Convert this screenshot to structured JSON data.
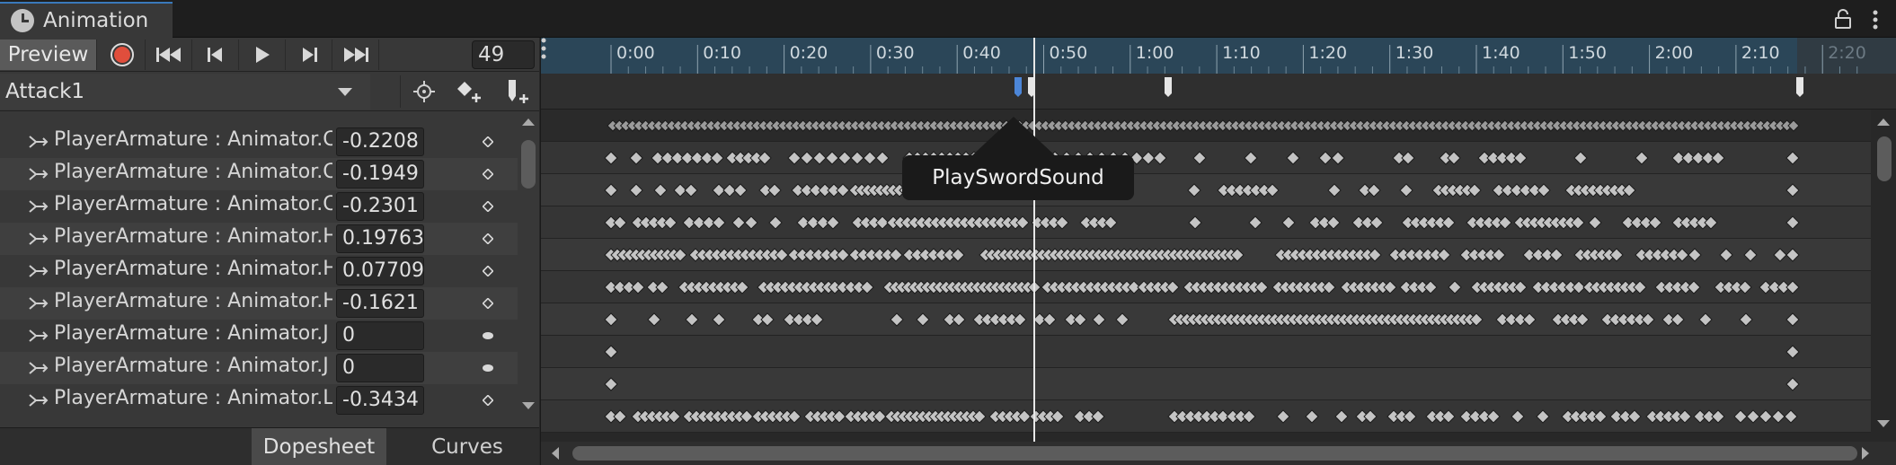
{
  "window": {
    "title": "Animation",
    "tab_icon": "animation-clock-icon",
    "lock_icon": "lock-icon",
    "menu_icon": "kebab-menu-icon"
  },
  "toolbar": {
    "preview_label": "Preview",
    "frame": "49",
    "record_color": "#e04e3c"
  },
  "clip": {
    "name": "Attack1"
  },
  "properties": [
    {
      "name": "PlayerArmature : Animator.C",
      "value": "-0.2208",
      "key": "diamond"
    },
    {
      "name": "PlayerArmature : Animator.C",
      "value": "-0.1949",
      "key": "diamond"
    },
    {
      "name": "PlayerArmature : Animator.C",
      "value": "-0.2301",
      "key": "diamond"
    },
    {
      "name": "PlayerArmature : Animator.H",
      "value": "0.19763",
      "key": "diamond"
    },
    {
      "name": "PlayerArmature : Animator.H",
      "value": "0.07709",
      "key": "diamond"
    },
    {
      "name": "PlayerArmature : Animator.H",
      "value": "-0.1621",
      "key": "diamond"
    },
    {
      "name": "PlayerArmature : Animator.J",
      "value": "0",
      "key": "ellipse"
    },
    {
      "name": "PlayerArmature : Animator.J",
      "value": "0",
      "key": "ellipse"
    },
    {
      "name": "PlayerArmature : Animator.L",
      "value": "-0.3434",
      "key": "diamond"
    }
  ],
  "bottom_tabs": {
    "dopesheet": "Dopesheet",
    "curves": "Curves"
  },
  "timeline": {
    "ticks": [
      "0:00",
      "0:10",
      "0:20",
      "0:30",
      "0:40",
      "0:50",
      "1:00",
      "1:10",
      "1:20",
      "1:30",
      "1:40",
      "1:50",
      "2:00",
      "2:10",
      "2:20"
    ],
    "playhead_time": "0:49",
    "tooltip": "PlaySwordSound",
    "accent_color": "#2b4658",
    "key_color": "#c8c8c8"
  }
}
